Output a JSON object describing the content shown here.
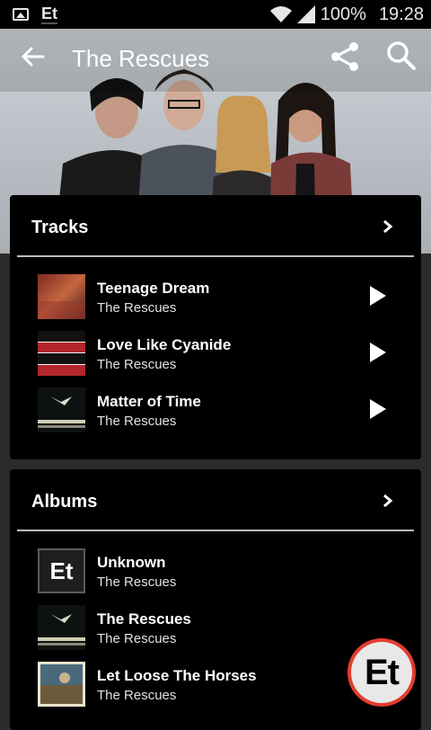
{
  "status_bar": {
    "app_label": "Et",
    "battery": "100%",
    "time": "19:28"
  },
  "app_bar": {
    "title": "The Rescues"
  },
  "tracks": {
    "header": "Tracks",
    "items": [
      {
        "title": "Teenage Dream",
        "artist": "The Rescues"
      },
      {
        "title": "Love Like Cyanide",
        "artist": "The Rescues"
      },
      {
        "title": "Matter of Time",
        "artist": "The Rescues"
      }
    ]
  },
  "albums": {
    "header": "Albums",
    "items": [
      {
        "title": "Unknown",
        "artist": "The Rescues",
        "thumb_text": "Et"
      },
      {
        "title": "The Rescues",
        "artist": "The Rescues"
      },
      {
        "title": "Let Loose The Horses",
        "artist": "The Rescues"
      }
    ]
  },
  "fab": {
    "label": "Et"
  },
  "colors": {
    "accent": "#e33c2f",
    "card": "#000000",
    "background": "#2b2b2b"
  }
}
